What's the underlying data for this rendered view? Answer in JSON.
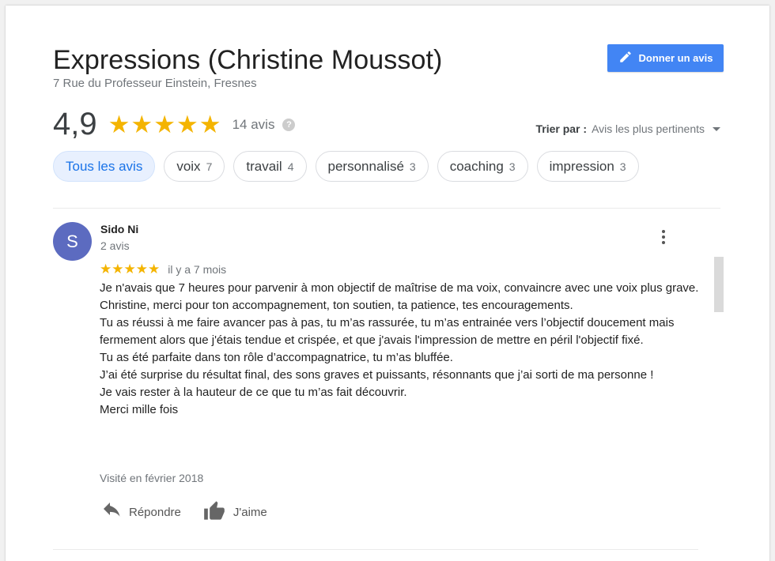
{
  "place": {
    "title": "Expressions (Christine Moussot)",
    "address": "7 Rue du Professeur Einstein, Fresnes"
  },
  "write_review": {
    "label": "Donner un avis",
    "icon": "pencil-icon"
  },
  "summary": {
    "rating": "4,9",
    "stars": 5,
    "count_label": "14 avis",
    "help_icon": "?"
  },
  "sort": {
    "label": "Trier par :",
    "value": "Avis les plus pertinents"
  },
  "chips": [
    {
      "label": "Tous les avis",
      "count": ""
    },
    {
      "label": "voix",
      "count": "7"
    },
    {
      "label": "travail",
      "count": "4"
    },
    {
      "label": "personnalisé",
      "count": "3"
    },
    {
      "label": "coaching",
      "count": "3"
    },
    {
      "label": "impression",
      "count": "3"
    }
  ],
  "review": {
    "avatar_letter": "S",
    "author": "Sido Ni",
    "author_reviews": "2 avis",
    "stars": 5,
    "age": "il y a 7 mois",
    "lines": [
      "Je n'avais que 7 heures pour parvenir à mon objectif de maîtrise de ma voix, convaincre avec une voix plus grave.",
      "Christine, merci pour ton accompagnement, ton soutien, ta patience, tes encouragements.",
      "Tu as réussi à me faire avancer pas à pas, tu m’as rassurée, tu m’as entrainée vers l’objectif doucement mais fermement alors que j'étais tendue et crispée, et que j'avais l'impression de mettre en péril l'objectif fixé.",
      "Tu as été parfaite dans ton rôle d’accompagnatrice, tu m’as bluffée.",
      "J’ai été surprise du résultat final, des sons graves et puissants, résonnants que j’ai sorti de ma personne !",
      "Je vais rester à la hauteur de ce que tu m’as fait découvrir.",
      "Merci mille fois"
    ],
    "visited": "Visité en février 2018",
    "reply_label": "Répondre",
    "like_label": "J'aime"
  },
  "colors": {
    "star": "#f4b400",
    "button": "#4285f4",
    "avatar": "#5c6bc0",
    "chip_active_bg": "#e8f0fe",
    "chip_active_text": "#1a73e8"
  }
}
